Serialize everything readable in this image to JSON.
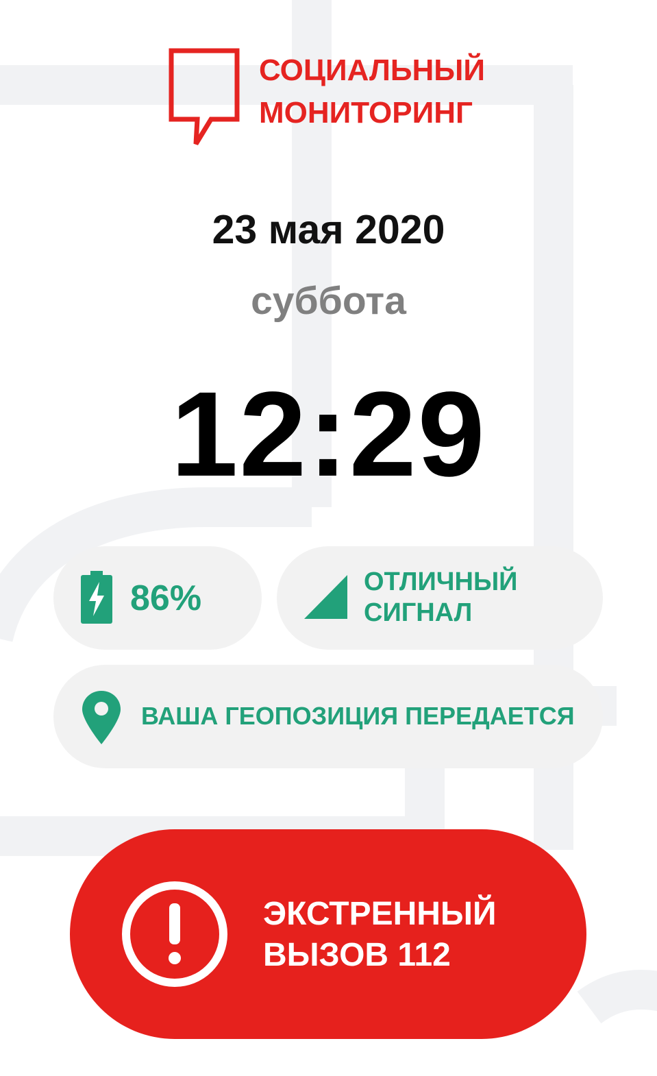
{
  "logo": {
    "line1": "СОЦИАЛЬНЫЙ",
    "line2": "МОНИТОРИНГ",
    "icon": "speech-bubble-icon",
    "color": "#e52421"
  },
  "date": "23 мая 2020",
  "weekday": "суббота",
  "time": "12:29",
  "battery": {
    "icon": "battery-charging-icon",
    "percent_text": "86%",
    "level": 0.86
  },
  "signal": {
    "icon": "signal-strength-icon",
    "line1": "ОТЛИЧНЫЙ",
    "line2": "СИГНАЛ"
  },
  "geo": {
    "icon": "location-pin-icon",
    "text": "ВАША ГЕОПОЗИЦИЯ ПЕРЕДАЕТСЯ"
  },
  "emergency": {
    "icon": "exclamation-circle-icon",
    "line1": "ЭКСТРЕННЫЙ",
    "line2": "ВЫЗОВ 112",
    "color": "#e6211d"
  },
  "colors": {
    "accent_green": "#22a17a",
    "pill_bg": "#f2f2f2",
    "muted_text": "#808080"
  }
}
